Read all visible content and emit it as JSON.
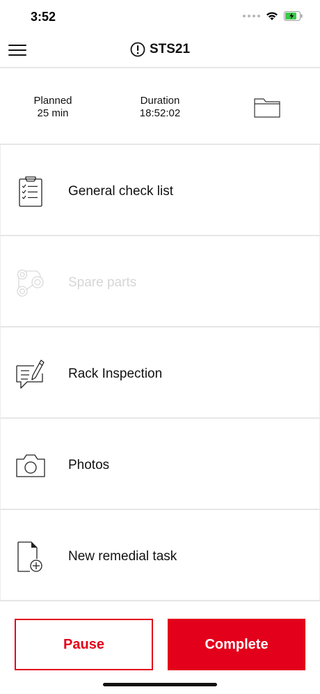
{
  "status_bar": {
    "time": "3:52",
    "icons": [
      "cellular-dots-icon",
      "wifi-icon",
      "battery-charging-icon"
    ]
  },
  "nav": {
    "title": "STS21",
    "menu_icon": "hamburger-menu-icon",
    "title_icon": "alert-circle-icon"
  },
  "summary": {
    "planned_label": "Planned",
    "planned_value": "25 min",
    "duration_label": "Duration",
    "duration_value": "18:52:02",
    "folder_icon": "folder-icon"
  },
  "tasks": [
    {
      "label": "General check list",
      "icon": "clipboard-checklist-icon",
      "enabled": true
    },
    {
      "label": "Spare parts",
      "icon": "gears-icon",
      "enabled": false
    },
    {
      "label": "Rack Inspection",
      "icon": "speech-pencil-icon",
      "enabled": true
    },
    {
      "label": "Photos",
      "icon": "camera-icon",
      "enabled": true
    },
    {
      "label": "New remedial task",
      "icon": "document-plus-icon",
      "enabled": true
    }
  ],
  "buttons": {
    "pause_label": "Pause",
    "complete_label": "Complete"
  },
  "colors": {
    "accent": "#e3001b",
    "battery": "#3cc94b",
    "disabled_text": "#d6d6d6",
    "divider": "#e6e6e6"
  }
}
